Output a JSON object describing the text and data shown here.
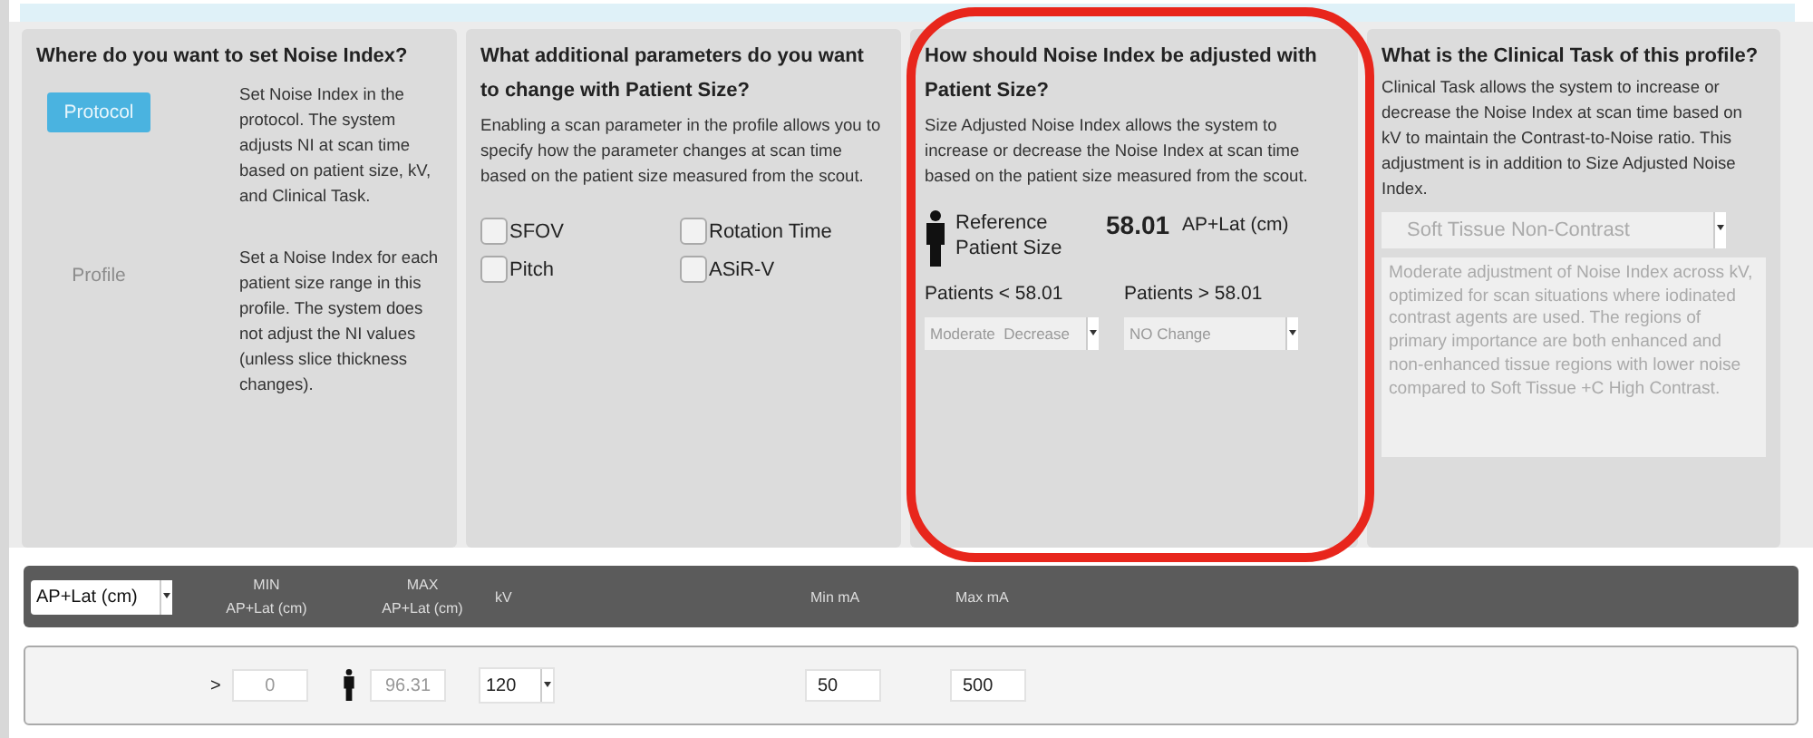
{
  "noise_index_location": {
    "title": "Where do you want to set Noise Index?",
    "options": [
      {
        "label": "Protocol",
        "selected": true,
        "description": "Set Noise Index in the protocol. The system adjusts NI at scan time based on patient size, kV, and Clinical Task."
      },
      {
        "label": "Profile",
        "selected": false,
        "description": "Set a Noise Index for each patient size range in this profile. The system does not adjust the NI values (unless slice thickness changes)."
      }
    ]
  },
  "additional_parameters": {
    "title": "What additional parameters do you want to change with Patient Size?",
    "description": "Enabling a scan parameter in the profile allows you to specify how the parameter changes at scan time based on the patient size measured from the scout.",
    "checkboxes": [
      {
        "label": "SFOV",
        "checked": false
      },
      {
        "label": "Rotation Time",
        "checked": false
      },
      {
        "label": "Pitch",
        "checked": false
      },
      {
        "label": "ASiR-V",
        "checked": false
      }
    ]
  },
  "size_adjustment": {
    "title": "How should Noise Index be adjusted with Patient Size?",
    "description": "Size Adjusted Noise Index allows the system to increase or decrease the Noise Index at scan time based on the patient size measured from the scout.",
    "reference_label": "Reference Patient Size",
    "reference_value": "58.01",
    "reference_unit": "AP+Lat (cm)",
    "ranges": [
      {
        "label": "Patients < 58.01",
        "value": "Moderate  Decrease"
      },
      {
        "label": "Patients > 58.01",
        "value": "NO Change"
      }
    ]
  },
  "clinical_task": {
    "title": "What is the Clinical Task of this profile?",
    "description": "Clinical Task allows the system to increase or decrease the Noise Index at scan time based on kV to maintain the Contrast-to-Noise ratio. This adjustment is in addition to Size Adjusted Noise Index.",
    "task": "Soft Tissue Non-Contrast",
    "task_description": "Moderate adjustment of Noise Index across kV, optimized for scan situations where iodinated contrast agents are used. The regions of primary importance are both enhanced and non-enhanced tissue regions with lower noise compared to Soft Tissue +C High Contrast."
  },
  "table": {
    "size_unit": "AP+Lat (cm)",
    "columns": [
      {
        "label": "MIN",
        "sublabel": "AP+Lat (cm)"
      },
      {
        "label": "MAX",
        "sublabel": "AP+Lat (cm)"
      },
      {
        "label": "kV"
      },
      {
        "label": "Min mA"
      },
      {
        "label": "Max mA"
      }
    ],
    "rows": [
      {
        "operator": ">",
        "min": "0",
        "max": "96.31",
        "kv": "120",
        "min_ma": "50",
        "max_ma": "500"
      }
    ]
  }
}
